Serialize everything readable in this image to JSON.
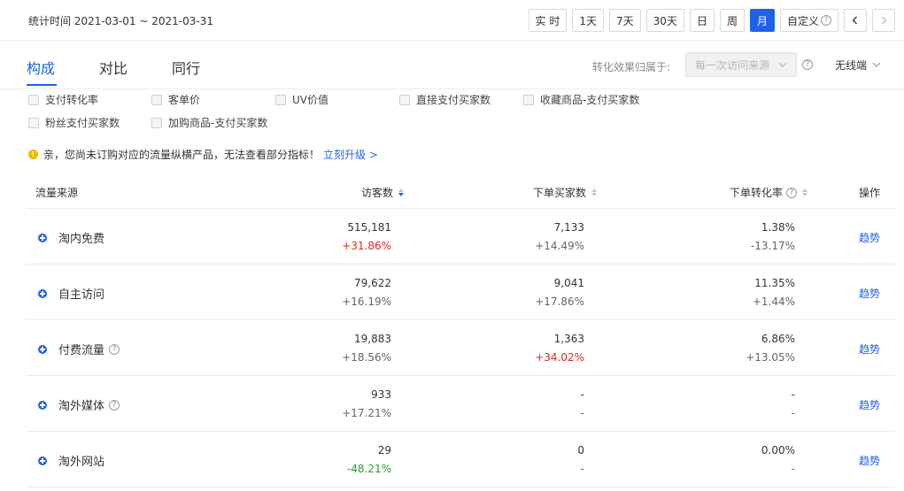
{
  "header": {
    "stat_time": "统计时间 2021-03-01 ~ 2021-03-31",
    "periods": [
      "实 时",
      "1天",
      "7天",
      "30天",
      "日",
      "周",
      "月"
    ],
    "active_period": "月",
    "custom_label": "自定义",
    "help_glyph": "?"
  },
  "tabs": {
    "items": [
      "构成",
      "对比",
      "同行"
    ],
    "active": "构成"
  },
  "attribution": {
    "label": "转化效果归属于:",
    "value": "每一次访问来源",
    "device": "无线端"
  },
  "metrics": [
    "支付转化率",
    "客单价",
    "UV价值",
    "直接支付买家数",
    "收藏商品-支付买家数",
    "粉丝支付买家数",
    "加购商品-支付买家数"
  ],
  "notice": {
    "text": "亲，您尚未订购对应的流量纵横产品，无法查看部分指标！",
    "link": "立刻升级 >"
  },
  "table": {
    "columns": [
      "流量来源",
      "访客数",
      "下单买家数",
      "下单转化率",
      "操作"
    ],
    "action_label": "趋势",
    "rows": [
      {
        "source": "淘内免费",
        "visitors": "515,181",
        "visitors_change": "+31.86%",
        "buyers": "7,133",
        "buyers_change": "+14.49%",
        "rate": "1.38%",
        "rate_change": "-13.17%"
      },
      {
        "source": "自主访问",
        "visitors": "79,622",
        "visitors_change": "+16.19%",
        "buyers": "9,041",
        "buyers_change": "+17.86%",
        "rate": "11.35%",
        "rate_change": "+1.44%"
      },
      {
        "source": "付费流量",
        "visitors": "19,883",
        "visitors_change": "+18.56%",
        "buyers": "1,363",
        "buyers_change": "+34.02%",
        "rate": "6.86%",
        "rate_change": "+13.05%"
      },
      {
        "source": "淘外媒体",
        "visitors": "933",
        "visitors_change": "+17.21%",
        "buyers": "-",
        "buyers_change": "-",
        "rate": "-",
        "rate_change": "-"
      },
      {
        "source": "淘外网站",
        "visitors": "29",
        "visitors_change": "-48.21%",
        "buyers": "0",
        "buyers_change": "-",
        "rate": "0.00%",
        "rate_change": "-"
      }
    ]
  },
  "colors": {
    "accent": "#2062e6",
    "positive_highlight": "#e0281e",
    "negative_highlight": "#2a9a3a"
  }
}
